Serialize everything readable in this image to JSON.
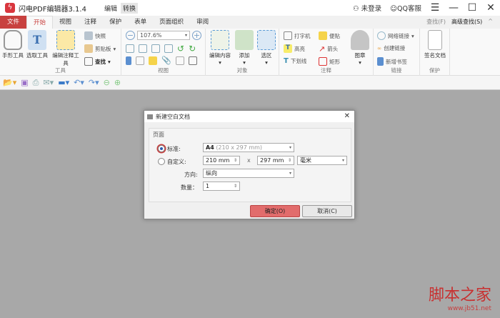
{
  "app": {
    "title": "闪电PDF编辑器3.1.4",
    "modes": [
      "编辑",
      "转换"
    ],
    "login": "未登录",
    "support": "QQ客服"
  },
  "tabs": [
    "文件",
    "开始",
    "视图",
    "注释",
    "保护",
    "表单",
    "页面组织",
    "审阅"
  ],
  "tab_right": {
    "find": "查找(F)",
    "adv_find": "高级查找(S)"
  },
  "ribbon": {
    "tools": {
      "label": "工具",
      "hand": "手形工具",
      "select": "选取工具",
      "edit_annot": "编辑注释工具",
      "snapshot": "快照",
      "clipboard": "剪贴板",
      "find": "查找"
    },
    "view": {
      "label": "视图",
      "zoom": "107.6%"
    },
    "object": {
      "label": "对象",
      "edit_content": "编辑内容",
      "add": "添加",
      "select_area": "选区"
    },
    "annot": {
      "label": "注释",
      "typewriter": "打字机",
      "note": "便贴",
      "highlight": "高亮",
      "arrow": "箭头",
      "underline": "下划线",
      "rect": "矩形",
      "stamp": "图章"
    },
    "link": {
      "label": "链接",
      "web": "网络链接",
      "create": "创建链接",
      "bookmark": "新增书签"
    },
    "protect": {
      "label": "保护",
      "sign": "签名文档"
    }
  },
  "dialog": {
    "title": "新建空白文档",
    "group": "页面",
    "standard": "标准:",
    "standard_val_main": "A4",
    "standard_val_sub": "(210 x 297 mm)",
    "custom": "自定义:",
    "width": "210 mm",
    "x": "x",
    "height": "297 mm",
    "unit": "毫米",
    "orient_label": "方向:",
    "orient": "纵向",
    "count_label": "数量：",
    "count": "1",
    "ok": "确定(O)",
    "cancel": "取消(C)",
    "standard_selected": true
  },
  "watermark": {
    "text": "脚本之家",
    "url": "www.jb51.net"
  }
}
